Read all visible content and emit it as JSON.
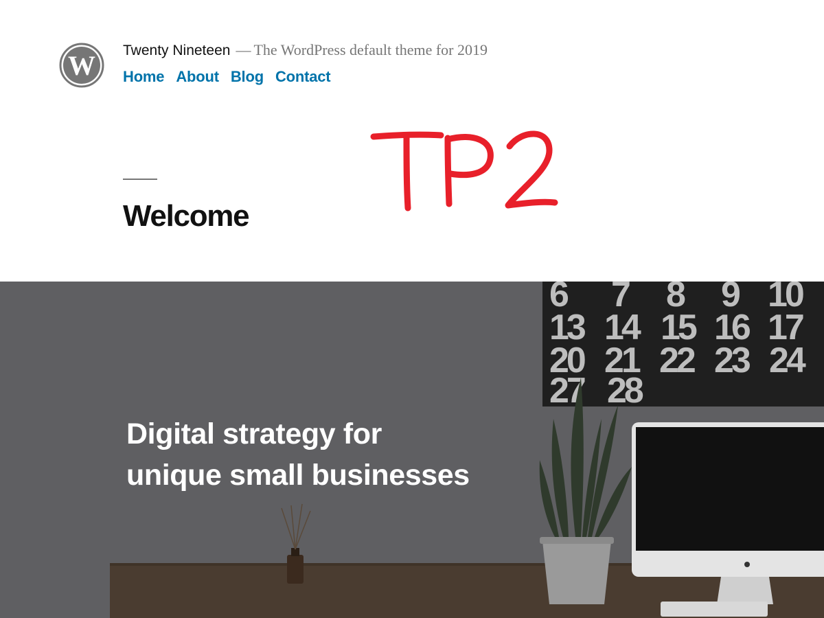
{
  "site": {
    "title": "Twenty Nineteen",
    "separator": "—",
    "description": "The WordPress default theme for 2019",
    "logo_icon": "wordpress-logo-icon"
  },
  "nav": {
    "items": [
      {
        "label": "Home"
      },
      {
        "label": "About"
      },
      {
        "label": "Blog"
      },
      {
        "label": "Contact"
      }
    ]
  },
  "entry": {
    "title": "Welcome"
  },
  "annotation": {
    "text": "TP2",
    "color": "#e8202a"
  },
  "cover": {
    "heading_line1": "Digital strategy for",
    "heading_line2": "unique small businesses",
    "calendar_rows": [
      [
        "6",
        "7",
        "8",
        "9",
        "10"
      ],
      [
        "13",
        "14",
        "15",
        "16",
        "17"
      ],
      [
        "20",
        "21",
        "22",
        "23",
        "24"
      ],
      [
        "27",
        "28"
      ]
    ],
    "overlay_color": "#5f5f62"
  },
  "colors": {
    "link": "#0073aa",
    "text": "#111111",
    "muted": "#767676"
  }
}
